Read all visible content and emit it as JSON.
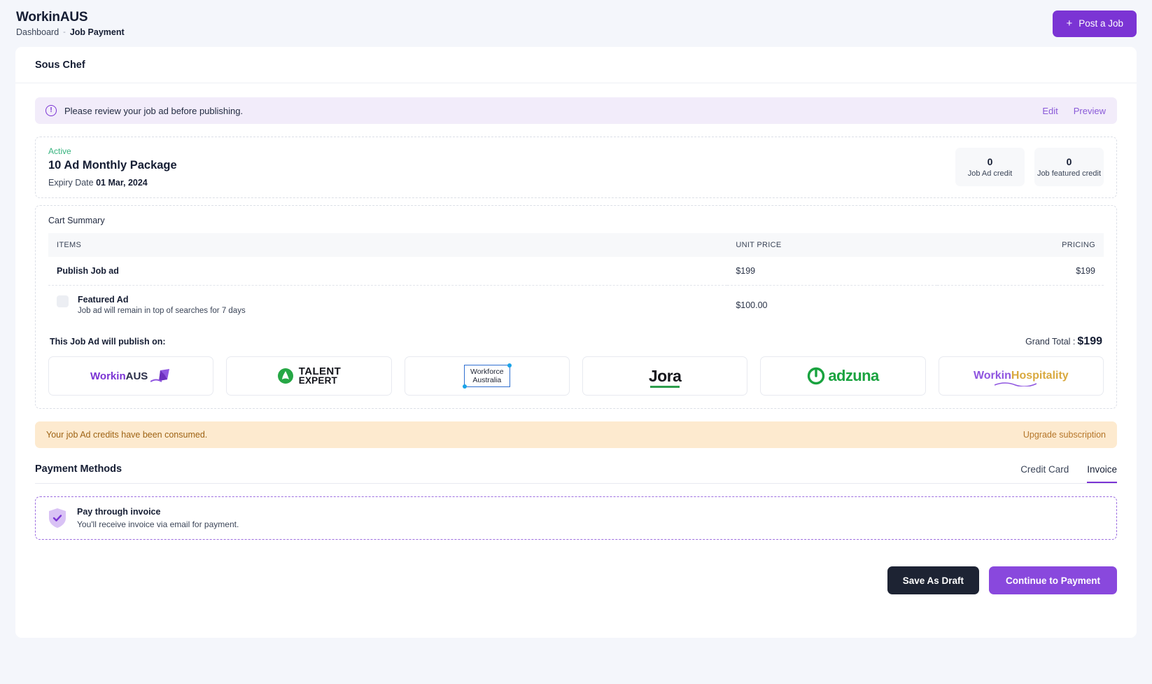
{
  "header": {
    "brand": "WorkinAUS",
    "breadcrumb": {
      "parent": "Dashboard",
      "separator": "-",
      "current": "Job Payment"
    },
    "post_job_button": "Post a Job",
    "plus_icon": "plus-icon"
  },
  "job": {
    "title": "Sous Chef"
  },
  "review_alert": {
    "icon": "info-circle-icon",
    "message": "Please review your job ad before publishing.",
    "edit_label": "Edit",
    "preview_label": "Preview"
  },
  "package": {
    "status": "Active",
    "name": "10 Ad Monthly Package",
    "expiry_label": "Expiry Date",
    "expiry_date": "01 Mar, 2024",
    "credits": [
      {
        "value": "0",
        "label": "Job Ad credit"
      },
      {
        "value": "0",
        "label": "Job featured credit"
      }
    ]
  },
  "cart": {
    "title": "Cart Summary",
    "columns": [
      "ITEMS",
      "UNIT PRICE",
      "PRICING"
    ],
    "rows": [
      {
        "name": "Publish Job ad",
        "description": "",
        "unit_price": "$199",
        "pricing": "$199",
        "has_checkbox": false
      },
      {
        "name": "Featured Ad",
        "description": "Job ad will remain in top of searches for 7 days",
        "unit_price": "$100.00",
        "pricing": "",
        "has_checkbox": true
      }
    ]
  },
  "publish": {
    "label": "This Job Ad will publish on:",
    "grand_total_label": "Grand Total :",
    "grand_total_value": "$199",
    "partners": [
      {
        "name": "WorkinAUS",
        "icon": "workinaus-logo"
      },
      {
        "name": "TALENT EXPERT",
        "icon": "talent-expert-logo"
      },
      {
        "name": "Workforce Australia",
        "icon": "workforce-australia-logo"
      },
      {
        "name": "Jora",
        "icon": "jora-logo"
      },
      {
        "name": "adzuna",
        "icon": "adzuna-logo"
      },
      {
        "name": "WorkinHospitality",
        "icon": "workinhospitality-logo"
      }
    ]
  },
  "credits_warning": {
    "message": "Your job Ad credits have been consumed.",
    "link": "Upgrade subscription"
  },
  "payment": {
    "title": "Payment Methods",
    "tabs": [
      {
        "label": "Credit Card",
        "active": false
      },
      {
        "label": "Invoice",
        "active": true
      }
    ],
    "selected_method": {
      "icon": "shield-check-icon",
      "name": "Pay through invoice",
      "description": "You'll receive invoice via email for payment."
    }
  },
  "footer": {
    "save_draft": "Save As Draft",
    "continue": "Continue to Payment"
  },
  "colors": {
    "accent": "#7b34d4",
    "dark": "#1d2333",
    "success": "#36b37e",
    "warning_bg": "#fdeacf",
    "alert_bg": "#f2ecfa"
  }
}
